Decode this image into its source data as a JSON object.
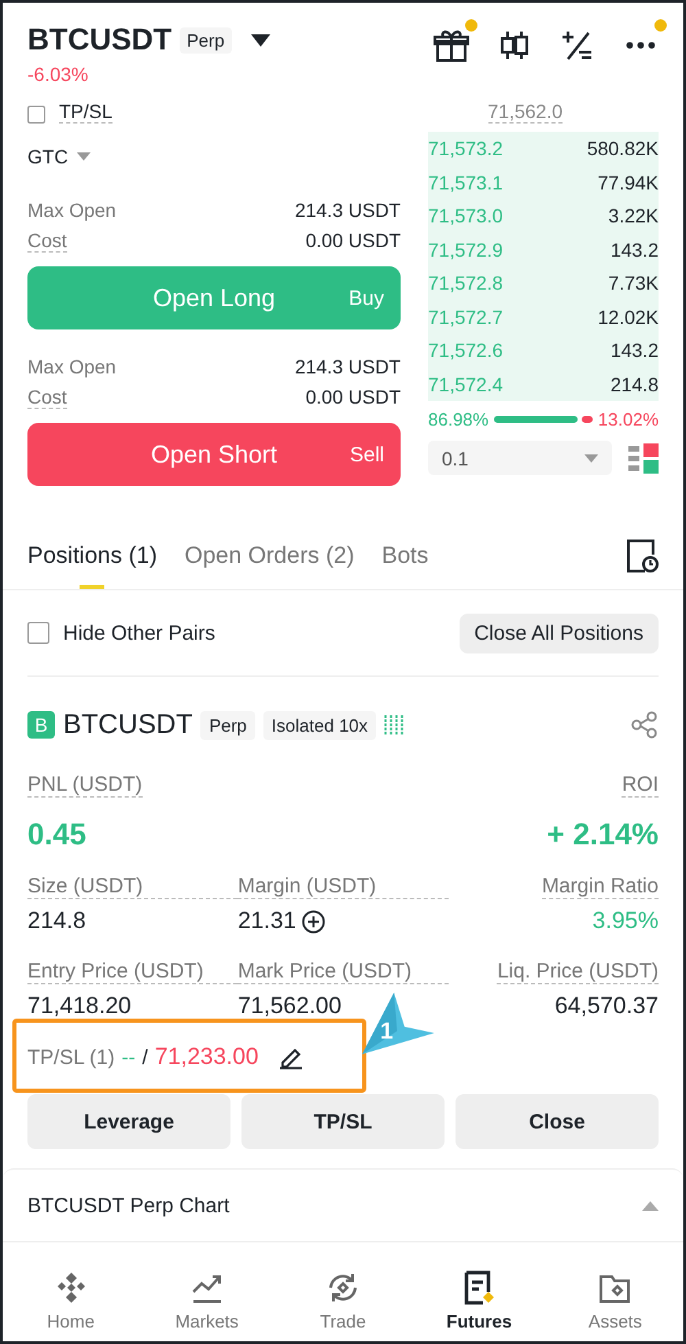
{
  "header": {
    "symbol": "BTCUSDT",
    "badge": "Perp",
    "change": "-6.03%",
    "toolbar": [
      {
        "kind": "gift",
        "dot": true
      },
      {
        "kind": "candles",
        "dot": false
      },
      {
        "kind": "calculator",
        "dot": false
      },
      {
        "kind": "more",
        "dot": true
      }
    ]
  },
  "order_form": {
    "tpsl": {
      "label": "TP/SL",
      "checked": false
    },
    "time_in_force": "GTC",
    "sides": [
      {
        "kind": "long",
        "max_open_label": "Max Open",
        "max_open": "214.3 USDT",
        "cost_label": "Cost",
        "cost": "0.00 USDT",
        "button": "Open Long",
        "side": "Buy"
      },
      {
        "kind": "short",
        "max_open_label": "Max Open",
        "max_open": "214.3 USDT",
        "cost_label": "Cost",
        "cost": "0.00 USDT",
        "button": "Open Short",
        "side": "Sell"
      }
    ]
  },
  "order_book": {
    "last_price": "71,562.0",
    "bids": [
      {
        "price": "71,573.2",
        "amount": "580.82K"
      },
      {
        "price": "71,573.1",
        "amount": "77.94K"
      },
      {
        "price": "71,573.0",
        "amount": "3.22K"
      },
      {
        "price": "71,572.9",
        "amount": "143.2"
      },
      {
        "price": "71,572.8",
        "amount": "7.73K"
      },
      {
        "price": "71,572.7",
        "amount": "12.02K"
      },
      {
        "price": "71,572.6",
        "amount": "143.2"
      },
      {
        "price": "71,572.4",
        "amount": "214.8"
      }
    ],
    "buy_ratio": "86.98%",
    "sell_ratio": "13.02%",
    "precision": "0.1"
  },
  "tabs": [
    {
      "label": "Positions (1)",
      "selected": true
    },
    {
      "label": "Open Orders (2)",
      "selected": false
    },
    {
      "label": "Bots",
      "selected": false
    }
  ],
  "filter": {
    "label": "Hide Other Pairs",
    "checked": false,
    "button": "Close All Positions"
  },
  "position": {
    "icon_letter": "B",
    "symbol": "BTCUSDT",
    "badges": [
      "Perp",
      "Isolated 10x"
    ],
    "pnl_label": "PNL (USDT)",
    "pnl": "0.45",
    "roi_label": "ROI",
    "roi": "+ 2.14%",
    "fields": [
      {
        "label": "Size (USDT)",
        "value": "214.8",
        "kind": "plain"
      },
      {
        "label": "Margin (USDT)",
        "value": "21.31",
        "kind": "add"
      },
      {
        "label": "Margin Ratio",
        "value": "3.95%",
        "kind": "positive"
      },
      {
        "label": "Entry Price (USDT)",
        "value": "71,418.20",
        "kind": "plain"
      },
      {
        "label": "Mark Price (USDT)",
        "value": "71,562.00",
        "kind": "plain"
      },
      {
        "label": "Liq. Price (USDT)",
        "value": "64,570.37",
        "kind": "plain"
      }
    ],
    "tpsl_label": "TP/SL (1)",
    "tp": "--",
    "separator": "/",
    "sl": "71,233.00",
    "actions": [
      "Leverage",
      "TP/SL",
      "Close"
    ]
  },
  "chart_bar": {
    "label": "BTCUSDT Perp Chart"
  },
  "nav": [
    {
      "label": "Home",
      "kind": "home",
      "selected": false
    },
    {
      "label": "Markets",
      "kind": "markets",
      "selected": false
    },
    {
      "label": "Trade",
      "kind": "trade",
      "selected": false
    },
    {
      "label": "Futures",
      "kind": "futures",
      "selected": true
    },
    {
      "label": "Assets",
      "kind": "assets",
      "selected": false
    }
  ],
  "annotation": {
    "number": "1"
  }
}
